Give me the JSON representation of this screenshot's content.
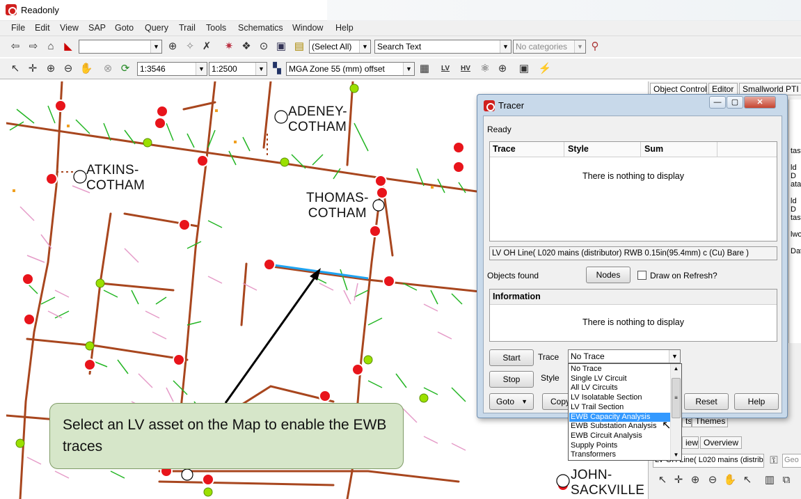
{
  "window": {
    "title": "Readonly"
  },
  "menu": [
    "File",
    "Edit",
    "View",
    "SAP",
    "Goto",
    "Query",
    "Trail",
    "Tools",
    "Schematics",
    "Window",
    "Help"
  ],
  "toolbar1": {
    "select_all": "(Select All)",
    "search_placeholder": "Search Text",
    "categories": "No categories"
  },
  "toolbar2": {
    "scale1": "1:3546",
    "scale2": "1:2500",
    "projection": "MGA Zone 55 (mm) offset",
    "lv_label": "LV",
    "hv_label": "HV"
  },
  "map": {
    "places": [
      {
        "name": "ADENEY-\nCOTHAM"
      },
      {
        "name": "ATKINS-\nCOTHAM"
      },
      {
        "name": "THOMAS-\nCOTHAM"
      },
      {
        "name": "JOHN-\nSACKVILLE"
      }
    ]
  },
  "right_panel": {
    "tabs": [
      "Object Control",
      "Editor",
      "Smallworld PTI Ir"
    ],
    "side_items": [
      "tastc",
      "ld D",
      "atas",
      "ld D",
      "tastc",
      "lwo",
      "Dat"
    ],
    "lower_tabs": [
      "ts",
      "Themes",
      "iew",
      "Overview"
    ],
    "line_text": "LV OH Line( L020 mains (distrib",
    "geo_placeholder": "Geo"
  },
  "tracer": {
    "title": "Tracer",
    "status": "Ready",
    "trace_table": {
      "columns": [
        "Trace",
        "Style",
        "Sum"
      ],
      "empty": "There is nothing to display"
    },
    "selection_text": "LV OH Line( L020 mains (distributor) RWB 0.15in(95.4mm) c (Cu) Bare )",
    "objects_found_label": "Objects found",
    "nodes_button": "Nodes",
    "draw_on_refresh": "Draw on Refresh?",
    "information": {
      "header": "Information",
      "empty": "There is nothing to display"
    },
    "start_button": "Start",
    "stop_button": "Stop",
    "goto_button": "Goto",
    "copy_button": "Copy",
    "reset_button": "Reset",
    "help_button": "Help",
    "trace_label": "Trace",
    "style_label": "Style",
    "trace_value": "No Trace",
    "trace_options": [
      "No Trace",
      "Single LV Circuit",
      "All LV Circuits",
      "LV Isolatable Section",
      "LV Trail Section",
      "EWB Capacity Analysis",
      "EWB Substation Analysis",
      "EWB Circuit Analysis",
      "Supply Points",
      "Transformers"
    ],
    "selected_option_index": 5
  },
  "callout": {
    "text": "Select an LV asset on the Map to enable the EWB traces"
  },
  "colors": {
    "node_red": "#e8141b",
    "node_green": "#9be000",
    "road_brown": "#a8461e",
    "green_line": "#23b523",
    "pink_line": "#e59bc8",
    "highlight_blue": "#1fa3f0",
    "callout_fill": "#d6e6c9"
  }
}
